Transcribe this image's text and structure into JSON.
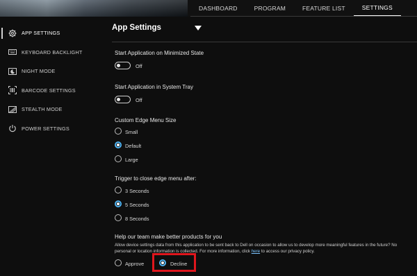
{
  "nav": {
    "tabs": [
      {
        "label": "DASHBOARD"
      },
      {
        "label": "PROGRAM"
      },
      {
        "label": "FEATURE LIST"
      },
      {
        "label": "SETTINGS"
      }
    ],
    "active_tab": "SETTINGS"
  },
  "sidebar": {
    "items": [
      {
        "label": "APP SETTINGS",
        "icon": "gear-icon"
      },
      {
        "label": "KEYBOARD BACKLIGHT",
        "icon": "keyboard-icon"
      },
      {
        "label": "NIGHT MODE",
        "icon": "night-mode-icon"
      },
      {
        "label": "BARCODE SETTINGS",
        "icon": "barcode-icon"
      },
      {
        "label": "STEALTH MODE",
        "icon": "stealth-icon"
      },
      {
        "label": "POWER SETTINGS",
        "icon": "power-icon"
      }
    ],
    "active_item": "APP SETTINGS"
  },
  "main": {
    "title": "App Settings",
    "start_minimized": {
      "label": "Start Application on Minimized State",
      "state": "Off"
    },
    "start_tray": {
      "label": "Start Application in System Tray",
      "state": "Off"
    },
    "menu_size": {
      "label": "Custom Edge Menu Size",
      "options": [
        "Small",
        "Default",
        "Large"
      ],
      "selected": "Default"
    },
    "trigger": {
      "label": "Trigger to close edge menu after:",
      "options": [
        "3 Seconds",
        "5 Seconds",
        "8 Seconds"
      ],
      "selected": "5 Seconds"
    },
    "feedback": {
      "label": "Help our team make better products for you",
      "desc_before": "Allow device settings data from this application to be sent back to Dell on occasion to allow us to develop more meaningful features in the future? No personal or location information is collected. For more information, click ",
      "link": "here",
      "desc_after": " to access our privacy policy.",
      "options": [
        "Approve",
        "Decline"
      ],
      "selected": "Decline"
    }
  },
  "colors": {
    "accent": "#4fb3f2",
    "highlight": "#e0161d",
    "background": "#0e0e0e"
  }
}
